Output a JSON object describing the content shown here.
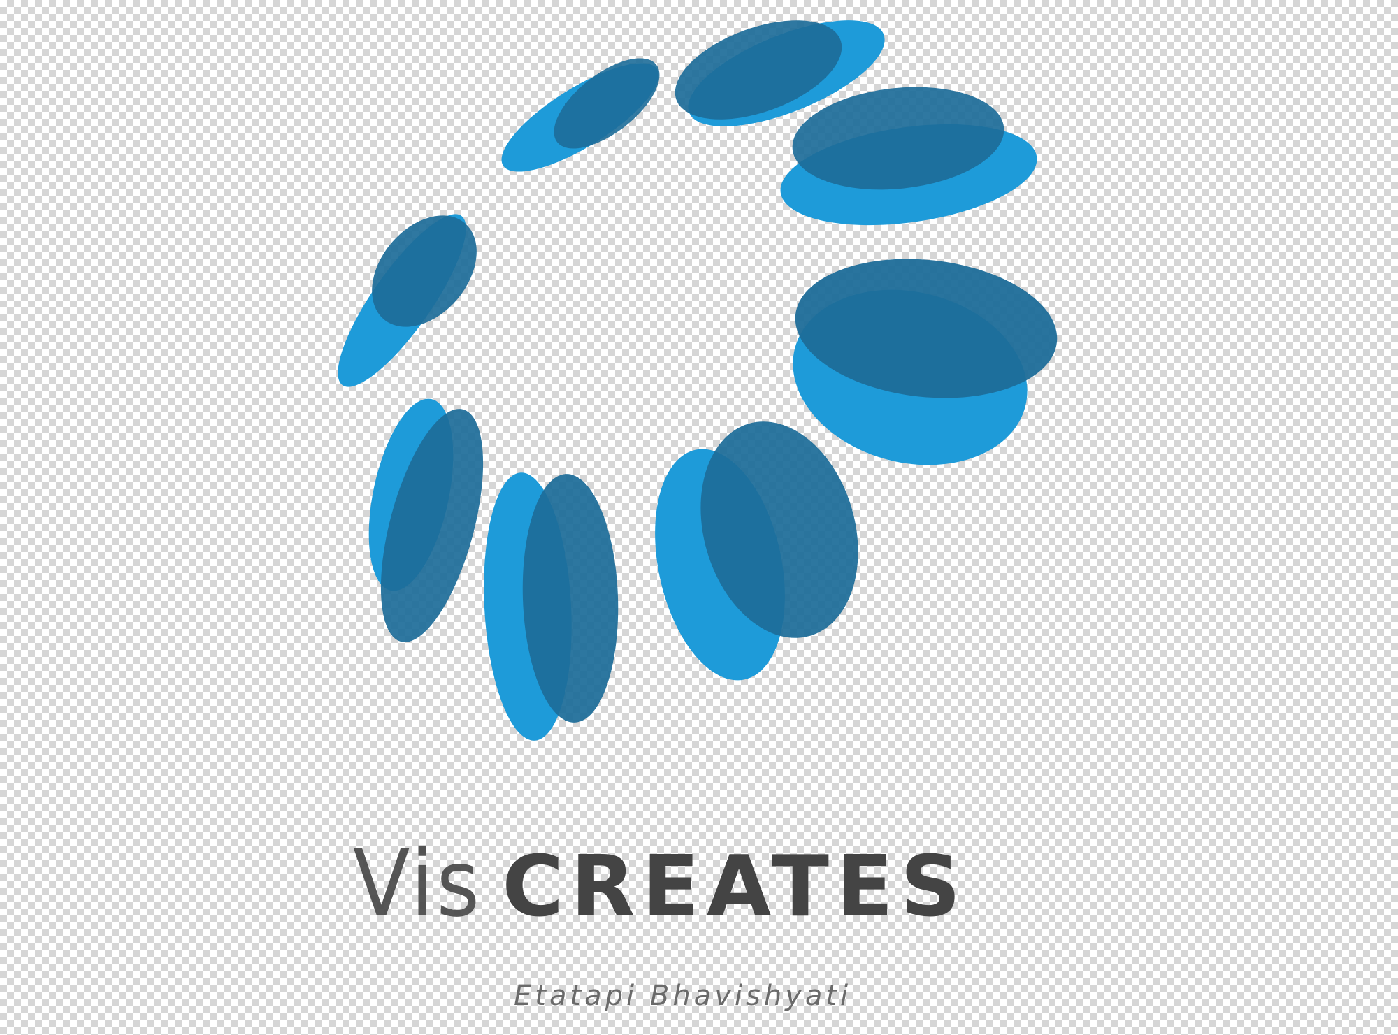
{
  "logo": {
    "name_part_1": "Vis",
    "name_part_2": "CREATES",
    "tagline": "Etatapi Bhavishyati",
    "icon": "petal-circle-icon",
    "colors": {
      "petal_light": "#1e9bd9",
      "petal_dark": "#1d6d99",
      "text_dark": "#444444",
      "text_tagline": "#6a6a6a",
      "transparency_checker_light": "#ffffff",
      "transparency_checker_dark": "#d6d6d6"
    }
  }
}
